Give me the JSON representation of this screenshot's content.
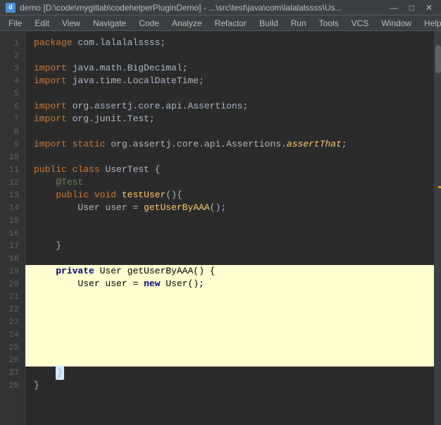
{
  "titleBar": {
    "icon": "d",
    "title": "demo [D:\\code\\mygitlab\\codehelperPluginDemo] - ...\\src\\test\\java\\com\\lalalalssss\\Us...",
    "minimize": "—",
    "maximize": "□",
    "close": "✕"
  },
  "menuBar": {
    "items": [
      "File",
      "Edit",
      "View",
      "Navigate",
      "Code",
      "Analyze",
      "Refactor",
      "Build",
      "Run",
      "Tools",
      "VCS",
      "Window",
      "Help"
    ]
  },
  "code": {
    "lines": [
      "package com.lalalalssss;",
      "",
      "import java.math.BigDecimal;",
      "import java.time.LocalDateTime;",
      "",
      "import org.assertj.core.api.Assertions;",
      "import org.junit.Test;",
      "",
      "import static org.assertj.core.api.Assertions.assertThat;",
      "",
      "public class UserTest {",
      "    @Test",
      "    public void testUser(){",
      "        User user = getUserByAAA();",
      "",
      "",
      "    }",
      "",
      "    private User getUserByAAA() {",
      "        User user = new User();",
      "",
      "",
      "",
      "",
      "",
      "",
      "    }",
      "}"
    ]
  }
}
